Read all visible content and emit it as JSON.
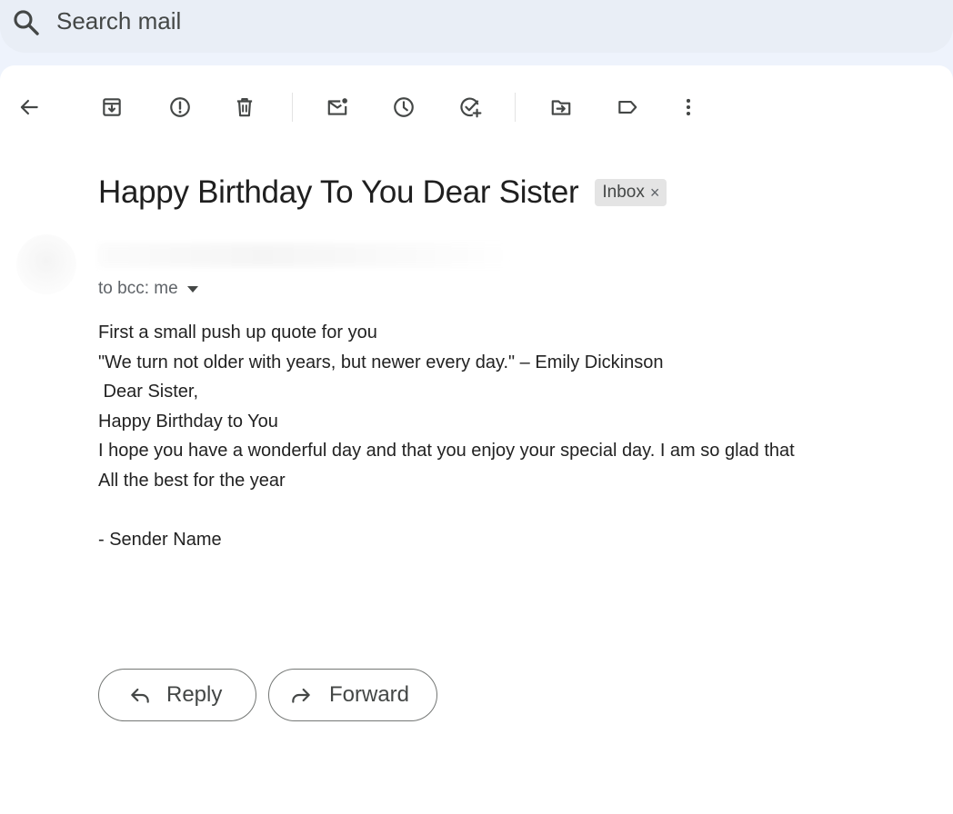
{
  "search": {
    "placeholder": "Search mail",
    "icon": "search-icon"
  },
  "toolbar": {
    "items": [
      {
        "name": "back",
        "icon": "arrow-left-icon"
      },
      {
        "name": "archive",
        "icon": "archive-icon"
      },
      {
        "name": "report-spam",
        "icon": "report-spam-icon"
      },
      {
        "name": "delete",
        "icon": "trash-icon"
      },
      {
        "name": "mark-unread",
        "icon": "mark-unread-icon"
      },
      {
        "name": "snooze",
        "icon": "clock-icon"
      },
      {
        "name": "add-to-tasks",
        "icon": "add-task-icon"
      },
      {
        "name": "move-to",
        "icon": "move-to-folder-icon"
      },
      {
        "name": "labels",
        "icon": "label-icon"
      },
      {
        "name": "more",
        "icon": "more-vert-icon"
      }
    ]
  },
  "message": {
    "subject": "Happy Birthday To You Dear Sister",
    "label": "Inbox",
    "label_remove": "×",
    "recipients": "to bcc: me",
    "body_lines": [
      "First a small push up quote for you",
      "\"We turn not older with years, but newer every day.\" – Emily Dickinson",
      " Dear Sister,",
      "Happy Birthday to You",
      "I hope you have a wonderful day and that you enjoy your special day. I am so glad that",
      "All the best for the year",
      "",
      "- Sender Name"
    ]
  },
  "actions": {
    "reply_label": "Reply",
    "forward_label": "Forward"
  },
  "colors": {
    "background": "#eef3fc",
    "panel": "#ffffff",
    "icon": "#444746",
    "text": "#1f1f1f",
    "chip": "#e4e4e4"
  }
}
